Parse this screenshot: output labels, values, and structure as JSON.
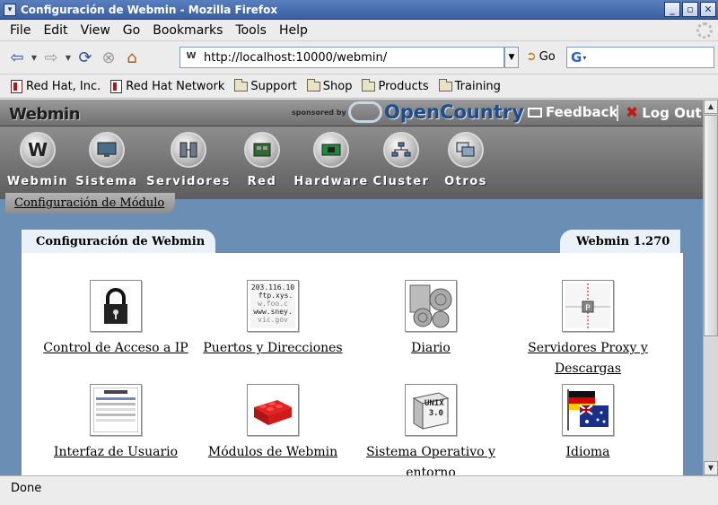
{
  "window": {
    "title": "Configuración de Webmin - Mozilla Firefox"
  },
  "menu": [
    "File",
    "Edit",
    "View",
    "Go",
    "Bookmarks",
    "Tools",
    "Help"
  ],
  "nav": {
    "url": "http://localhost:10000/webmin/",
    "go_label": "Go",
    "search_placeholder": ""
  },
  "bookmarks": [
    {
      "label": "Red Hat, Inc.",
      "type": "page"
    },
    {
      "label": "Red Hat Network",
      "type": "page"
    },
    {
      "label": "Support",
      "type": "folder"
    },
    {
      "label": "Shop",
      "type": "folder"
    },
    {
      "label": "Products",
      "type": "folder"
    },
    {
      "label": "Training",
      "type": "folder"
    }
  ],
  "webmin": {
    "logo": "Webmin",
    "sponsored": "sponsored by",
    "sponsor": "OpenCountry",
    "feedback": "Feedback",
    "logout": "Log Out",
    "categories": [
      "Webmin",
      "Sistema",
      "Servidores",
      "Red",
      "Hardware",
      "Cluster",
      "Otros"
    ],
    "module_config": "Configuración de Módulo",
    "page_title": "Configuración de Webmin",
    "version": "Webmin 1.270",
    "modules": [
      {
        "label": "Control de Acceso a IP",
        "icon": "lock-icon"
      },
      {
        "label": "Puertos y Direcciones",
        "icon": "ports-icon"
      },
      {
        "label": "Diario",
        "icon": "logs-icon"
      },
      {
        "label": "Servidores Proxy y Descargas",
        "icon": "proxy-icon"
      },
      {
        "label": "Interfaz de Usuario",
        "icon": "ui-icon"
      },
      {
        "label": "Módulos de Webmin",
        "icon": "lego-brick-icon"
      },
      {
        "label": "Sistema Operativo y entorno",
        "icon": "unix-box-icon"
      },
      {
        "label": "Idioma",
        "icon": "flags-icon"
      }
    ],
    "ports_icon_text": [
      "203.116.10",
      "ftp.xys.",
      "w.foo.c",
      "www.sney.",
      "vic.gov"
    ],
    "unix_icon_text": [
      "UNIX",
      "3.0"
    ]
  },
  "status": "Done"
}
